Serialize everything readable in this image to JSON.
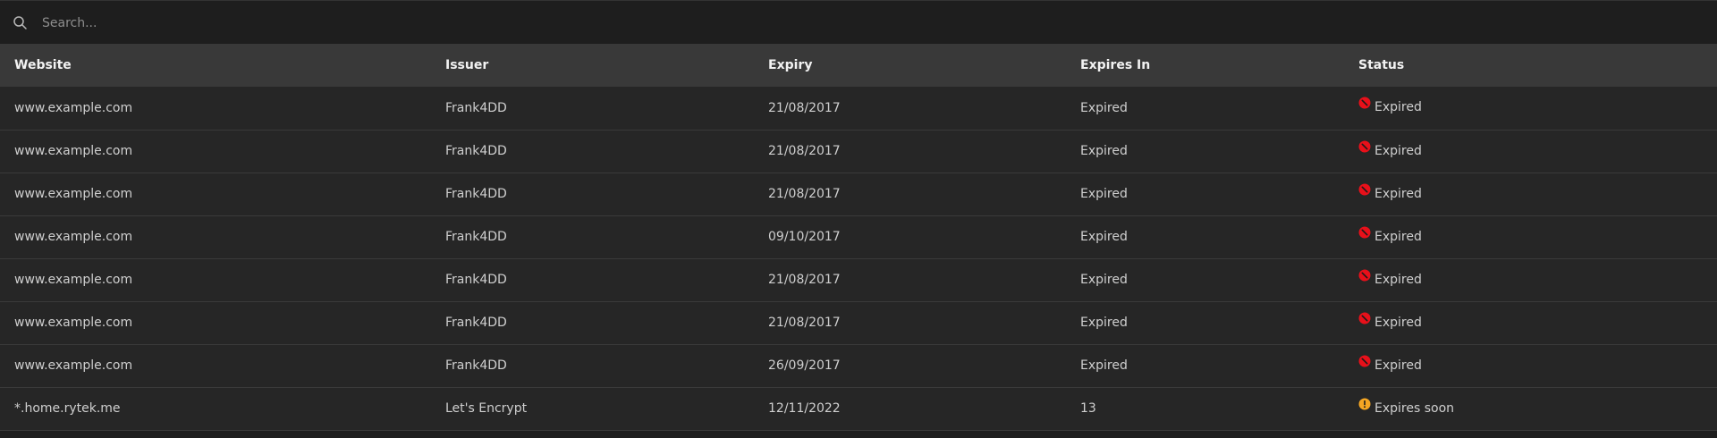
{
  "search": {
    "placeholder": "Search...",
    "value": ""
  },
  "table": {
    "columns": [
      "Website",
      "Issuer",
      "Expiry",
      "Expires In",
      "Status"
    ],
    "rows": [
      {
        "website": "www.example.com",
        "issuer": "Frank4DD",
        "expiry": "21/08/2017",
        "expires_in": "Expired",
        "status": "Expired",
        "status_icon": "expired-icon"
      },
      {
        "website": "www.example.com",
        "issuer": "Frank4DD",
        "expiry": "21/08/2017",
        "expires_in": "Expired",
        "status": "Expired",
        "status_icon": "expired-icon"
      },
      {
        "website": "www.example.com",
        "issuer": "Frank4DD",
        "expiry": "21/08/2017",
        "expires_in": "Expired",
        "status": "Expired",
        "status_icon": "expired-icon"
      },
      {
        "website": "www.example.com",
        "issuer": "Frank4DD",
        "expiry": "09/10/2017",
        "expires_in": "Expired",
        "status": "Expired",
        "status_icon": "expired-icon"
      },
      {
        "website": "www.example.com",
        "issuer": "Frank4DD",
        "expiry": "21/08/2017",
        "expires_in": "Expired",
        "status": "Expired",
        "status_icon": "expired-icon"
      },
      {
        "website": "www.example.com",
        "issuer": "Frank4DD",
        "expiry": "21/08/2017",
        "expires_in": "Expired",
        "status": "Expired",
        "status_icon": "expired-icon"
      },
      {
        "website": "www.example.com",
        "issuer": "Frank4DD",
        "expiry": "26/09/2017",
        "expires_in": "Expired",
        "status": "Expired",
        "status_icon": "expired-icon"
      },
      {
        "website": "*.home.rytek.me",
        "issuer": "Let's Encrypt",
        "expiry": "12/11/2022",
        "expires_in": "13",
        "status": "Expires soon",
        "status_icon": "warning-icon"
      }
    ]
  },
  "colors": {
    "expired": "#e8101a",
    "warning": "#f5a623",
    "header_bg": "#393939",
    "row_bg": "#262626",
    "page_bg": "#1e1e1e"
  }
}
